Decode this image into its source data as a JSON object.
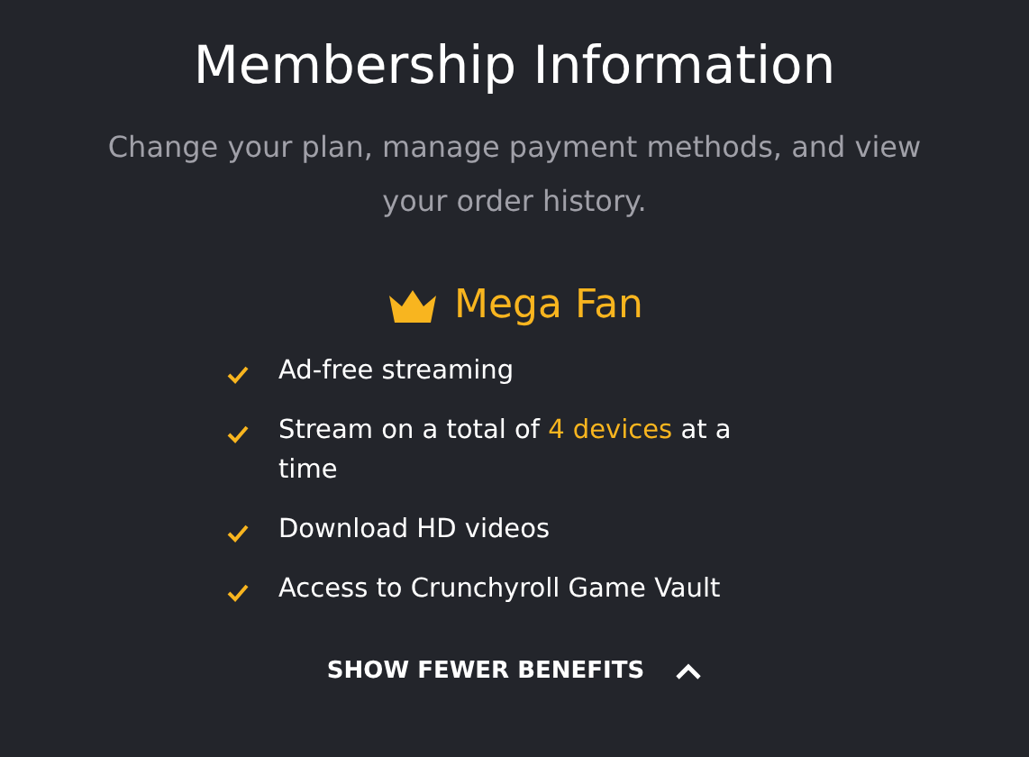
{
  "title": "Membership Information",
  "subtitle": "Change your plan, manage payment methods, and view your order history.",
  "plan": {
    "name": "Mega Fan"
  },
  "benefits": [
    {
      "parts": [
        {
          "text": "Ad-free streaming",
          "highlight": false
        }
      ]
    },
    {
      "parts": [
        {
          "text": "Stream on a total of ",
          "highlight": false
        },
        {
          "text": "4 devices",
          "highlight": true
        },
        {
          "text": " at a time",
          "highlight": false
        }
      ]
    },
    {
      "parts": [
        {
          "text": "Download HD videos",
          "highlight": false
        }
      ]
    },
    {
      "parts": [
        {
          "text": "Access to Crunchyroll Game Vault",
          "highlight": false
        }
      ]
    }
  ],
  "toggle": {
    "label": "SHOW FEWER BENEFITS",
    "expanded": true
  }
}
